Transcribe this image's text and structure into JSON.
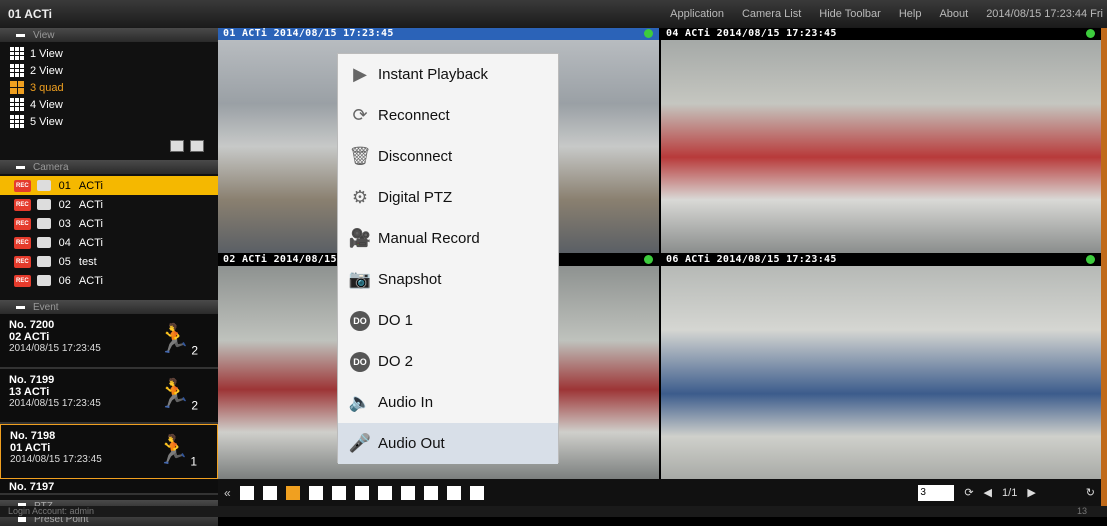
{
  "app": {
    "title": "01 ACTi"
  },
  "topmenu": {
    "items": [
      "Application",
      "Camera List",
      "Hide Toolbar",
      "Help",
      "About"
    ],
    "clock": "2014/08/15 17:23:44 Fri"
  },
  "sidebar": {
    "view_header": "View",
    "views": [
      {
        "label": "1 View",
        "icon": "grid-icon",
        "active": false
      },
      {
        "label": "2 View",
        "icon": "grid-icon",
        "active": false
      },
      {
        "label": "3 quad",
        "icon": "quad-icon",
        "active": true
      },
      {
        "label": "4 View",
        "icon": "grid-icon",
        "active": false
      },
      {
        "label": "5 View",
        "icon": "grid-icon",
        "active": false
      }
    ],
    "camera_header": "Camera",
    "cameras": [
      {
        "num": "01",
        "name": "ACTi",
        "rec": "REC",
        "active": true
      },
      {
        "num": "02",
        "name": "ACTi",
        "rec": "REC",
        "active": false
      },
      {
        "num": "03",
        "name": "ACTi",
        "rec": "REC",
        "active": false
      },
      {
        "num": "04",
        "name": "ACTi",
        "rec": "REC",
        "active": false
      },
      {
        "num": "05",
        "name": "test",
        "rec": "REC",
        "active": false
      },
      {
        "num": "06",
        "name": "ACTi",
        "rec": "REC",
        "active": false
      }
    ],
    "event_header": "Event",
    "events": [
      {
        "no": "No. 7200",
        "cam": "02 ACTi",
        "ts": "2014/08/15 17:23:45",
        "count": "2",
        "active": false
      },
      {
        "no": "No. 7199",
        "cam": "13 ACTi",
        "ts": "2014/08/15 17:23:45",
        "count": "2",
        "active": false
      },
      {
        "no": "No. 7198",
        "cam": "01 ACTi",
        "ts": "2014/08/15 17:23:45",
        "count": "1",
        "active": true
      }
    ],
    "event_partial": "No. 7197",
    "ptz_label": "PTZ",
    "preset_label": "Preset Point"
  },
  "tiles": [
    {
      "label": "01 ACTi  2014/08/15 17:23:45",
      "selected": true
    },
    {
      "label": "04 ACTi  2014/08/15 17:23:45",
      "selected": false
    },
    {
      "label": "02 ACTi  2014/08/15",
      "selected": false
    },
    {
      "label": "06 ACTi  2014/08/15 17:23:45",
      "selected": false
    }
  ],
  "context_menu": {
    "items": [
      {
        "label": "Instant Playback",
        "icon": "play-icon"
      },
      {
        "label": "Reconnect",
        "icon": "reconnect-icon"
      },
      {
        "label": "Disconnect",
        "icon": "trash-icon"
      },
      {
        "label": "Digital PTZ",
        "icon": "gear-icon"
      },
      {
        "label": "Manual Record",
        "icon": "camera-reel-icon"
      },
      {
        "label": "Snapshot",
        "icon": "snapshot-icon"
      },
      {
        "label": "DO 1",
        "icon": "do-icon",
        "badge": "DO"
      },
      {
        "label": "DO 2",
        "icon": "do-icon",
        "badge": "DO"
      },
      {
        "label": "Audio In",
        "icon": "speaker-icon"
      },
      {
        "label": "Audio Out",
        "icon": "microphone-icon"
      }
    ],
    "highlighted": "Audio Out"
  },
  "bottombar": {
    "page_input": "3",
    "page": "1/1"
  },
  "status": {
    "login": "Login Account: admin",
    "right": "13"
  }
}
